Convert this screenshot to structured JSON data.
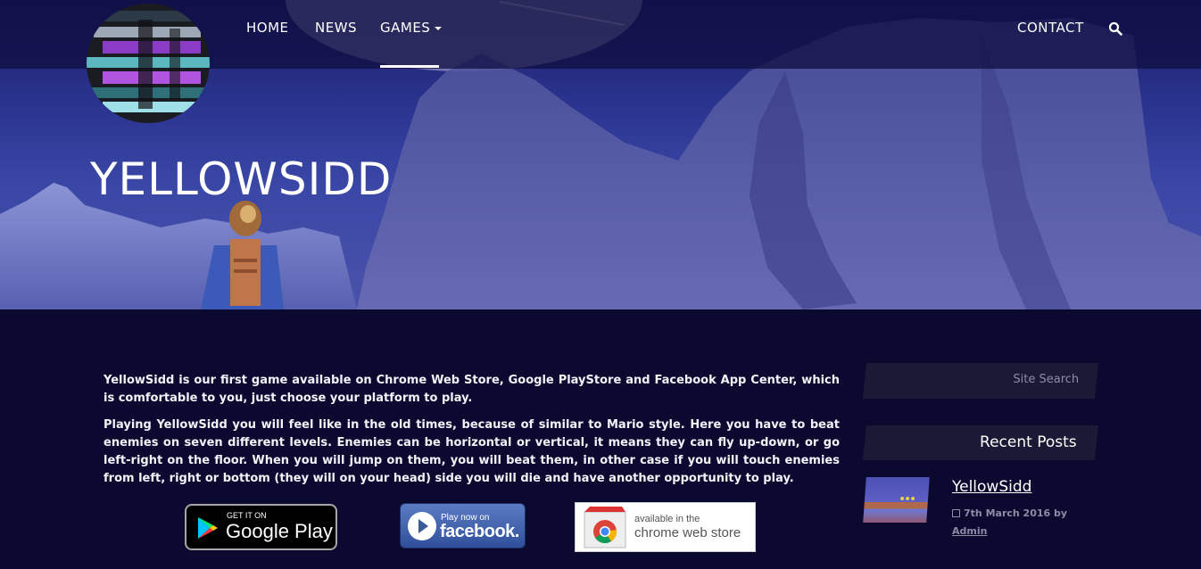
{
  "nav": {
    "home": "HOME",
    "news": "NEWS",
    "games": "GAMES",
    "contact": "CONTACT",
    "search_icon": "search-icon"
  },
  "hero": {
    "title": "YELLOWSIDD"
  },
  "content": {
    "paragraphs": [
      "YellowSidd is our first game available on Chrome Web Store, Google PlayStore and Facebook App Center, which is comfortable to you, just choose your platform to play.",
      "Playing YellowSidd you will feel like in the old times, because of  similar to Mario style. Here you have to beat enemies on seven different levels. Enemies can be horizontal or vertical, it means they can fly up-down, or go left-right on the floor. When you will jump on them, you will beat them, in other case if you will touch enemies from left, right or bottom (they will on your head) side you will die and have another opportunity to play."
    ]
  },
  "badges": {
    "google_play": {
      "small": "GET IT ON",
      "big": "Google Play"
    },
    "facebook": {
      "small": "Play now on",
      "big": "facebook."
    },
    "chrome": {
      "small": "available in the",
      "big": "chrome web store"
    }
  },
  "sidebar": {
    "search_placeholder": "Site Search",
    "recent_posts_title": "Recent Posts",
    "posts": [
      {
        "title": "YellowSidd",
        "date": "7th March 2016 by",
        "author": "Admin"
      }
    ]
  },
  "colors": {
    "page_bg": "#0b0930",
    "navbar_bg": "#0e0c3e",
    "sidebar_box": "#1a1936"
  }
}
